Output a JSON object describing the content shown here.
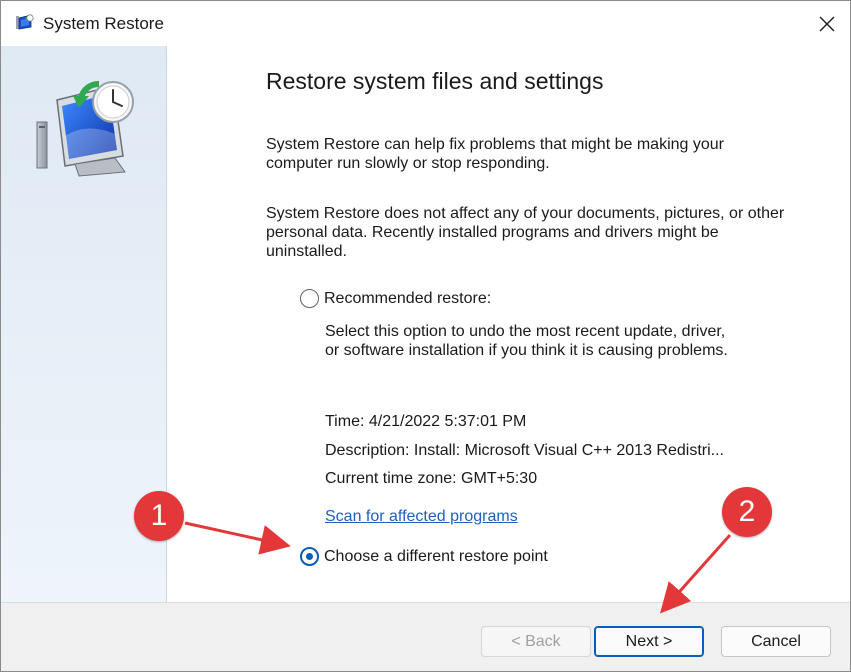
{
  "window": {
    "title": "System Restore"
  },
  "main": {
    "heading": "Restore system files and settings",
    "intro_line1": "System Restore can help fix problems that might be making your",
    "intro_line2": "computer run slowly or stop responding.",
    "info_line1": "System Restore does not affect any of your documents, pictures, or other",
    "info_line2": "personal data. Recently installed programs and drivers might be",
    "info_line3": "uninstalled."
  },
  "recommended": {
    "label": "Recommended restore:",
    "desc_line1": "Select this option to undo the most recent update, driver,",
    "desc_line2": "or software installation if you think it is causing problems.",
    "time": "Time: 4/21/2022 5:37:01 PM",
    "description": "Description: Install: Microsoft Visual C++ 2013 Redistri...",
    "timezone": "Current time zone: GMT+5:30",
    "scan_link": "Scan for affected programs",
    "selected": false
  },
  "different": {
    "label": "Choose a different restore point",
    "selected": true
  },
  "buttons": {
    "back": "< Back",
    "next": "Next >",
    "cancel": "Cancel"
  },
  "annotations": {
    "badge1": "1",
    "badge2": "2",
    "color": "#e2383a"
  },
  "colors": {
    "accent": "#0a5db3",
    "link": "#1f5fbf"
  },
  "icons": [
    "system-restore-icon",
    "close-icon",
    "monitor-clock-icon"
  ]
}
